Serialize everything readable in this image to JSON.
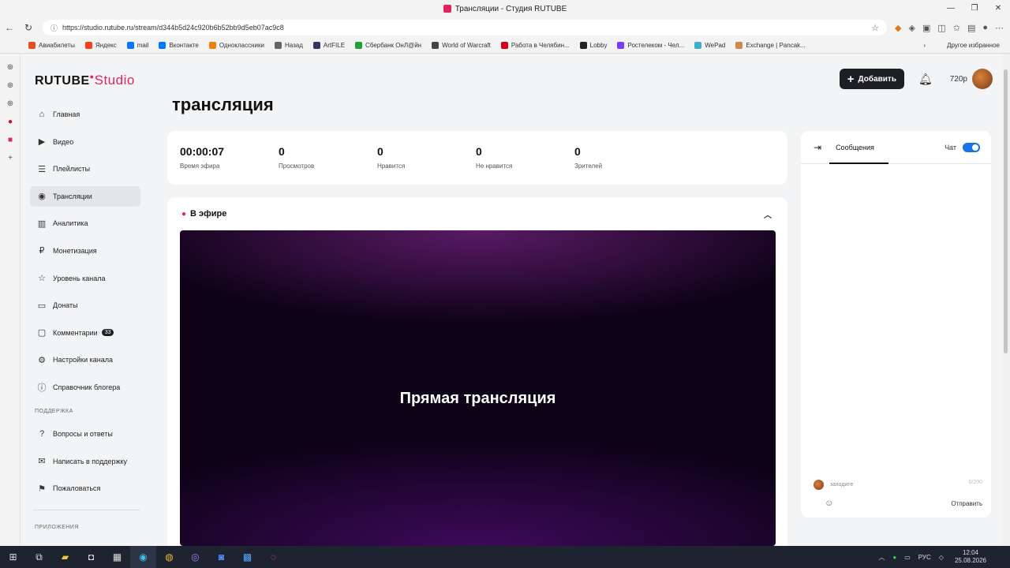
{
  "browser": {
    "tab_title": "Трансляции - Студия RUTUBE",
    "url": "https://studio.rutube.ru/stream/d344b5d24c920b6b52bb9d5eb07ac9c8",
    "bookmarks": [
      {
        "label": "Авиабилеты",
        "color": "#e94e1b"
      },
      {
        "label": "Яндекс",
        "color": "#fc3f1d"
      },
      {
        "label": "mail",
        "color": "#0077ff"
      },
      {
        "label": "Вконтакте",
        "color": "#0077ff"
      },
      {
        "label": "Одноклассники",
        "color": "#ee8208"
      },
      {
        "label": "Назад",
        "color": "#666666"
      },
      {
        "label": "ArtFILE",
        "color": "#333366"
      },
      {
        "label": "Сбербанк ОнЛ@йн",
        "color": "#21a038"
      },
      {
        "label": "World of Warcraft",
        "color": "#444444"
      },
      {
        "label": "Работа в Челябин...",
        "color": "#d6001c"
      },
      {
        "label": "Lobby",
        "color": "#222222"
      },
      {
        "label": "Ростелеком - Чел...",
        "color": "#7a3cff"
      },
      {
        "label": "WePad",
        "color": "#3cb0c8"
      },
      {
        "label": "Exchange | Pancak...",
        "color": "#d1884f"
      }
    ],
    "bookmarks_other": "Другое избранное"
  },
  "app": {
    "logo_main": "RUTUBE",
    "logo_sub": "Studio",
    "add_button": "Добавить",
    "balance": "720р"
  },
  "sidebar": {
    "items": [
      {
        "label": "Главная",
        "icon": "home-icon"
      },
      {
        "label": "Видео",
        "icon": "video-icon"
      },
      {
        "label": "Плейлисты",
        "icon": "playlist-icon"
      },
      {
        "label": "Трансляции",
        "icon": "broadcast-icon",
        "active": true
      },
      {
        "label": "Аналитика",
        "icon": "analytics-icon"
      },
      {
        "label": "Монетизация",
        "icon": "ruble-icon"
      },
      {
        "label": "Уровень канала",
        "icon": "star-icon"
      },
      {
        "label": "Донаты",
        "icon": "wallet-icon"
      },
      {
        "label": "Комментарии",
        "icon": "comment-icon",
        "badge": "33"
      },
      {
        "label": "Настройки канала",
        "icon": "gear-icon"
      },
      {
        "label": "Справочник блогера",
        "icon": "info-icon"
      }
    ],
    "support_label": "ПОДДЕРЖКА",
    "support_items": [
      {
        "label": "Вопросы и ответы",
        "icon": "question-icon"
      },
      {
        "label": "Написать в поддержку",
        "icon": "mail-icon"
      },
      {
        "label": "Пожаловаться",
        "icon": "flag-icon"
      }
    ],
    "apps_label": "ПРИЛОЖЕНИЯ"
  },
  "main": {
    "title": "трансляция",
    "stats": [
      {
        "value": "00:00:07",
        "label": "Время эфира"
      },
      {
        "value": "0",
        "label": "Просмотров"
      },
      {
        "value": "0",
        "label": "Нравится"
      },
      {
        "value": "0",
        "label": "Не нравится"
      },
      {
        "value": "0",
        "label": "Зрителей"
      }
    ],
    "live_label": "В эфире",
    "video_label": "Прямая трансляция"
  },
  "chat": {
    "tab_messages": "Сообщения",
    "chat_label": "Чат",
    "input_value": "заходите",
    "counter": "0/200",
    "send": "Отправить"
  },
  "taskbar": {
    "lang": "РУС",
    "time": "12:04",
    "date": "25.08.2026"
  }
}
